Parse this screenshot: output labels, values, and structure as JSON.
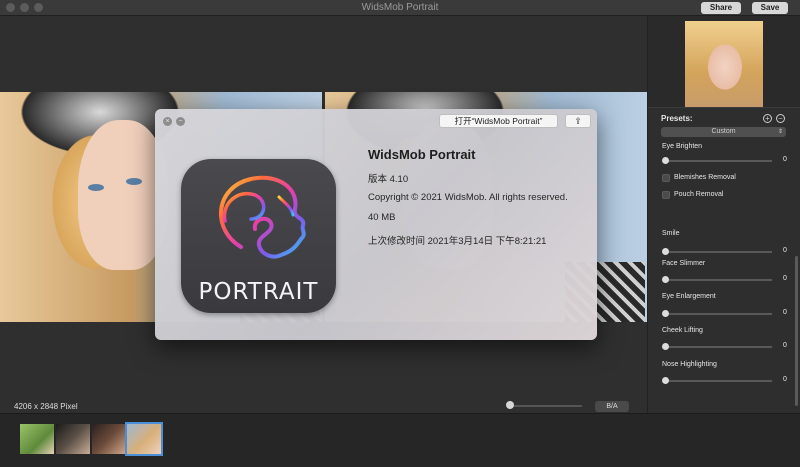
{
  "window": {
    "title": "WidsMob Portrait"
  },
  "toolbar": {
    "share_label": "Share",
    "save_label": "Save"
  },
  "canvas": {
    "pixel_info": "4206 x 2848 Pixel",
    "ba_label": "B/A"
  },
  "sidebar": {
    "presets_label": "Presets:",
    "preset_selected": "Custom",
    "adjustments": [
      {
        "label": "Eye Brighten",
        "value": "0"
      },
      {
        "label": "Smile",
        "value": "0"
      },
      {
        "label": "Face Slimmer",
        "value": "0"
      },
      {
        "label": "Eye Enlargement",
        "value": "0"
      },
      {
        "label": "Cheek Lifting",
        "value": "0"
      },
      {
        "label": "Nose Highlighting",
        "value": "0"
      }
    ],
    "checks": [
      {
        "label": "Blemishes Removal"
      },
      {
        "label": "Pouch Removal"
      }
    ]
  },
  "dialog": {
    "open_button": "打开“WidsMob Portrait”",
    "app_name": "WidsMob Portrait",
    "version": "版本 4.10",
    "copyright": "Copyright © 2021 WidsMob. All rights reserved.",
    "size": "40 MB",
    "modified": "上次修改时间 2021年3月14日 下午8:21:21",
    "icon_word": "PORTRAIT"
  },
  "colors": {
    "accent": "#4a90d9",
    "dialog_bg": "#d0d0d4"
  }
}
